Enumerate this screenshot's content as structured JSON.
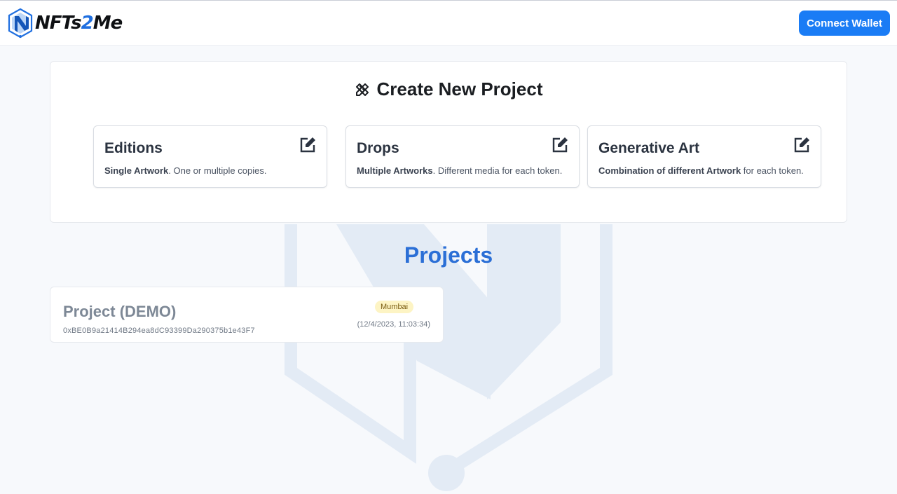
{
  "header": {
    "logo_prefix": "NFTs",
    "logo_two": "2",
    "logo_suffix": "Me",
    "connect_label": "Connect Wallet"
  },
  "create": {
    "title": "Create New Project",
    "options": [
      {
        "title": "Editions",
        "desc_bold": "Single Artwork",
        "desc_rest": ". One or multiple copies."
      },
      {
        "title": "Drops",
        "desc_bold": "Multiple Artworks",
        "desc_rest": ". Different media for each token."
      },
      {
        "title": "Generative Art",
        "desc_bold": "Combination of different Artwork",
        "desc_rest": " for each token."
      }
    ]
  },
  "projects": {
    "heading": "Projects",
    "items": [
      {
        "name": "Project (DEMO)",
        "address": "0xBE0B9a21414B294ea8dC93399Da290375b1e43F7",
        "network": "Mumbai",
        "date": "(12/4/2023, 11:03:34)"
      }
    ]
  },
  "icons": {
    "logo": "nfts2me-hex-logo-icon",
    "create": "crossed-pencil-ruler-icon",
    "option_edit": "edit-square-icon"
  },
  "colors": {
    "accent": "#1a7cf5",
    "projects_heading": "#2b6fd6",
    "badge_bg": "#fdf4c4"
  }
}
